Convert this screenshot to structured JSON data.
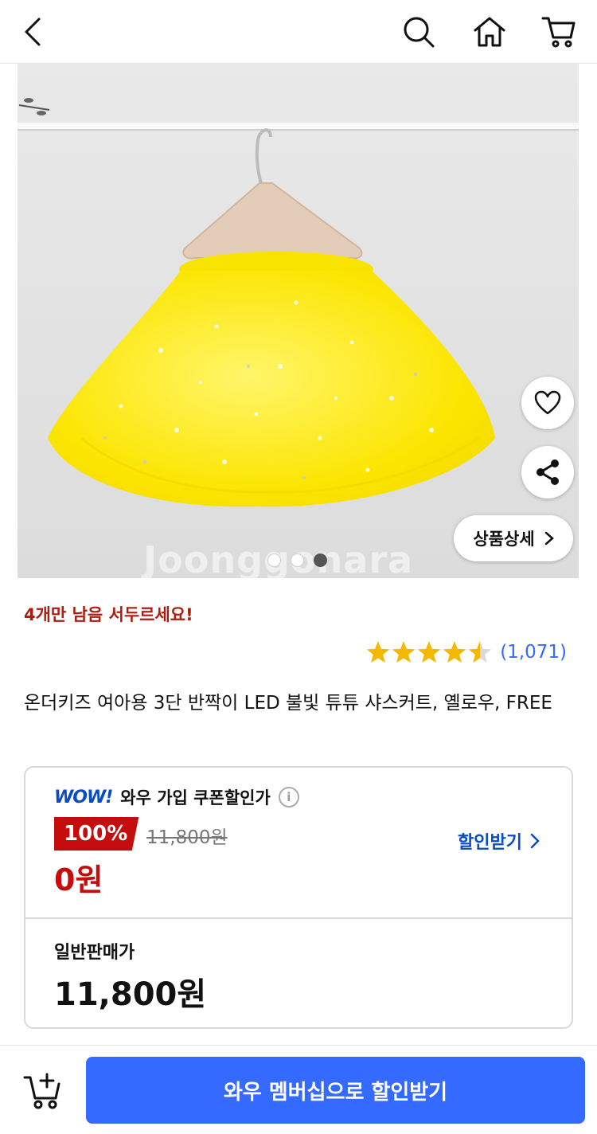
{
  "header": {
    "back_icon": "back-arrow-icon",
    "search_icon": "search-icon",
    "home_icon": "home-icon",
    "cart_icon": "cart-icon"
  },
  "gallery": {
    "watermark": "Joonggonara",
    "dots": [
      false,
      false,
      true
    ],
    "detail_label": "상품상세"
  },
  "product": {
    "stock_notice": "4개만 남음 서두르세요!",
    "rating": 4.5,
    "review_count": "(1,071)",
    "title": "온더키즈 여아용 3단 반짝이 LED 불빛 튜튜 샤스커트, 옐로우, FREE"
  },
  "price_card": {
    "wow_logo": "WOW!",
    "wow_label": "와우 가입 쿠폰할인가",
    "discount_percent": "100%",
    "original_price": "11,800원",
    "sale_price": "0원",
    "coupon_link": "할인받기",
    "normal_label": "일반판매가",
    "normal_price": "11,800원"
  },
  "bottom_bar": {
    "cta_label": "와우 멤버십으로 할인받기"
  },
  "colors": {
    "accent_blue": "#346aff",
    "wow_blue": "#0a4dc2",
    "discount_red": "#c50d0d",
    "stock_red": "#ad1d0f",
    "star_yellow": "#f5b800"
  }
}
